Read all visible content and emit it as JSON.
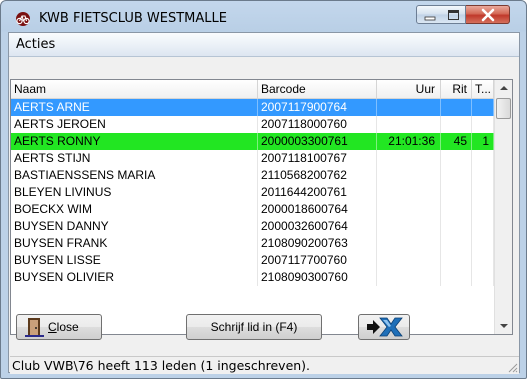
{
  "window": {
    "title": "KWB FIETSCLUB WESTMALLE"
  },
  "menu": {
    "items": [
      "Acties"
    ]
  },
  "table": {
    "columns": [
      "Naam",
      "Barcode",
      "Uur",
      "Rit",
      "T..."
    ],
    "rows": [
      {
        "naam": "AERTS ARNE",
        "barcode": "2007117900764",
        "uur": "",
        "rit": "",
        "t": "",
        "state": "selected"
      },
      {
        "naam": "AERTS JEROEN",
        "barcode": "2007118000760",
        "uur": "",
        "rit": "",
        "t": "",
        "state": ""
      },
      {
        "naam": "AERTS RONNY",
        "barcode": "2000003300761",
        "uur": "21:01:36",
        "rit": "45",
        "t": "1",
        "state": "present"
      },
      {
        "naam": "AERTS STIJN",
        "barcode": "2007118100767",
        "uur": "",
        "rit": "",
        "t": "",
        "state": ""
      },
      {
        "naam": "BASTIAENSSENS MARIA",
        "barcode": "2110568200762",
        "uur": "",
        "rit": "",
        "t": "",
        "state": ""
      },
      {
        "naam": "BLEYEN LIVINUS",
        "barcode": "2011644200761",
        "uur": "",
        "rit": "",
        "t": "",
        "state": ""
      },
      {
        "naam": "BOECKX WIM",
        "barcode": "2000018600764",
        "uur": "",
        "rit": "",
        "t": "",
        "state": ""
      },
      {
        "naam": "BUYSEN DANNY",
        "barcode": "2000032600764",
        "uur": "",
        "rit": "",
        "t": "",
        "state": ""
      },
      {
        "naam": "BUYSEN FRANK",
        "barcode": "2108090200763",
        "uur": "",
        "rit": "",
        "t": "",
        "state": ""
      },
      {
        "naam": "BUYSEN LISSE",
        "barcode": "2007117700760",
        "uur": "",
        "rit": "",
        "t": "",
        "state": ""
      },
      {
        "naam": "BUYSEN OLIVIER",
        "barcode": "2108090300760",
        "uur": "",
        "rit": "",
        "t": "",
        "state": ""
      }
    ]
  },
  "buttons": {
    "close_label": "Close",
    "close_accel": "C",
    "close_rest": "lose",
    "sign_label": "Schrijf lid in (F4)"
  },
  "status": {
    "text": "Club VWB\\76 heeft 113 leden (1 ingeschreven)."
  },
  "colors": {
    "selected": "#3399ff",
    "present": "#22e622"
  },
  "icons": [
    "bicycle-icon",
    "minimize-icon",
    "maximize-icon",
    "close-icon",
    "door-icon",
    "export-icon"
  ]
}
